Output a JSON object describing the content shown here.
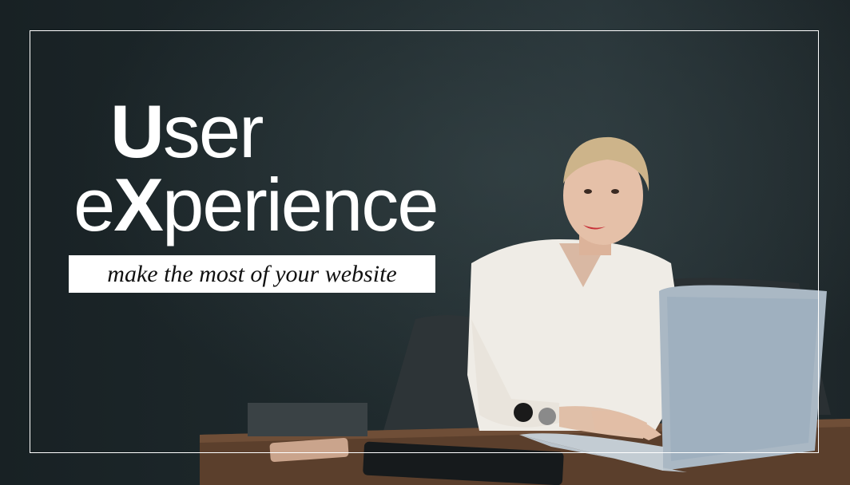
{
  "headline": {
    "line1_big": "U",
    "line1_rest": "ser",
    "line2_start": "e",
    "line2_big": "X",
    "line2_rest": "perience"
  },
  "tagline": "make the most of your website",
  "colors": {
    "background": "#1c2528",
    "frame": "#ffffff",
    "headline_text": "#ffffff",
    "tagline_box": "#ffffff",
    "tagline_text": "#111111"
  }
}
